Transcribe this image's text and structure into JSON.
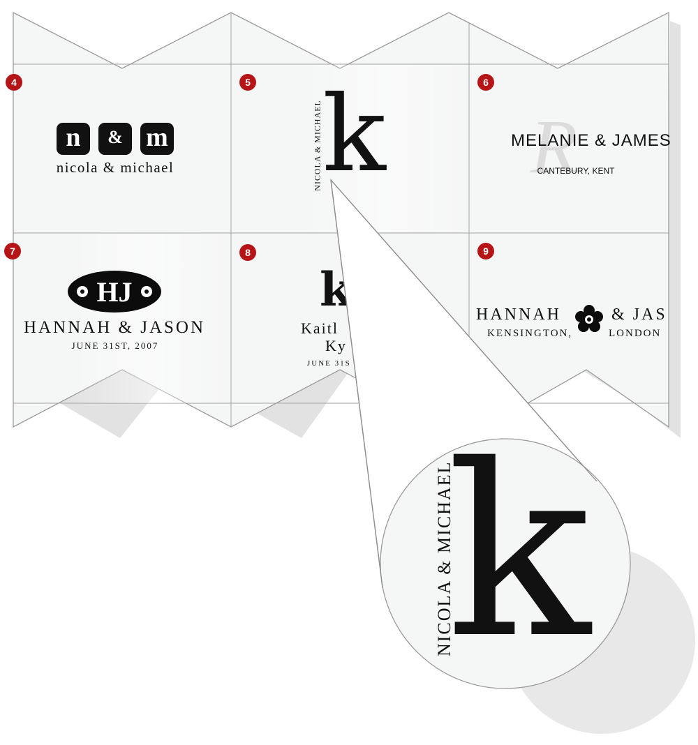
{
  "cards": [
    {
      "number": "4",
      "initial_left": "n",
      "ampersand": "&",
      "initial_right": "m",
      "names": "nicola & michael"
    },
    {
      "number": "5",
      "letter": "k",
      "vertical_names": "NICOLA & MICHAEL"
    },
    {
      "number": "6",
      "names": "MELANIE & JAMES",
      "place": "CANTEBURY, KENT",
      "watermark_letter": "R"
    },
    {
      "number": "7",
      "monogram": "HJ",
      "names": "HANNAH & JASON",
      "date": "JUNE 31ST, 2007"
    },
    {
      "number": "8",
      "letter": "k",
      "line1": "Kaitl",
      "line2": "Ky",
      "date": "JUNE 31S"
    },
    {
      "number": "9",
      "names_left": "HANNAH",
      "names_right": "& JAS",
      "place_left": "KENSINGTON,",
      "place_right": "LONDON"
    }
  ],
  "zoom": {
    "letter": "k",
    "vertical_names": "NICOLA & MICHAEL"
  },
  "colors": {
    "badge": "#b51517",
    "card": "#f4f5f5",
    "fold_line": "#9a9a9a",
    "shadow": "#e3e3e3"
  }
}
